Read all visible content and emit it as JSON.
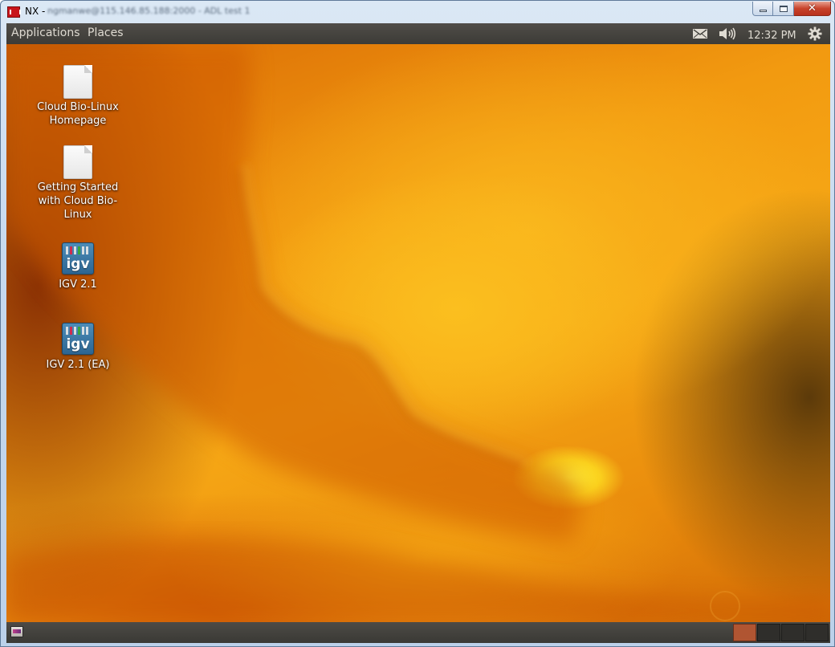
{
  "window": {
    "title": "NX -",
    "title_obscured": "ngmanwe@115.146.85.188:2000 - ADL test 1",
    "controls": [
      "minimize",
      "maximize",
      "close"
    ]
  },
  "top_panel": {
    "menus": [
      "Applications",
      "Places"
    ],
    "indicators": {
      "mail_icon": "envelope-icon",
      "sound_icon": "speaker-icon",
      "clock": "12:32 PM",
      "session_icon": "gear-icon"
    }
  },
  "desktop": {
    "icons": [
      {
        "label": "Cloud Bio-Linux Homepage",
        "lines": [
          "Cloud Bio-Linux",
          "Homepage"
        ],
        "icon": "document-icon"
      },
      {
        "label": "Getting Started with Cloud Bio-Linux",
        "lines": [
          "Getting Started",
          "with Cloud Bio-",
          "Linux"
        ],
        "icon": "document-icon"
      },
      {
        "label": "IGV 2.1",
        "lines": [
          "IGV 2.1"
        ],
        "icon": "igv-icon",
        "icon_text": "igv"
      },
      {
        "label": "IGV 2.1 (EA)",
        "lines": [
          "IGV 2.1 (EA)"
        ],
        "icon": "igv-icon",
        "icon_text": "igv"
      }
    ]
  },
  "bottom_panel": {
    "show_desktop_icon": "show-desktop-icon",
    "workspaces": 4,
    "active_workspace": 1
  },
  "colors": {
    "panel": "#3c3b37",
    "panel_text": "#dfdbd2",
    "active_workspace": "#b05532",
    "wallpaper_primary": "#f29a10"
  }
}
